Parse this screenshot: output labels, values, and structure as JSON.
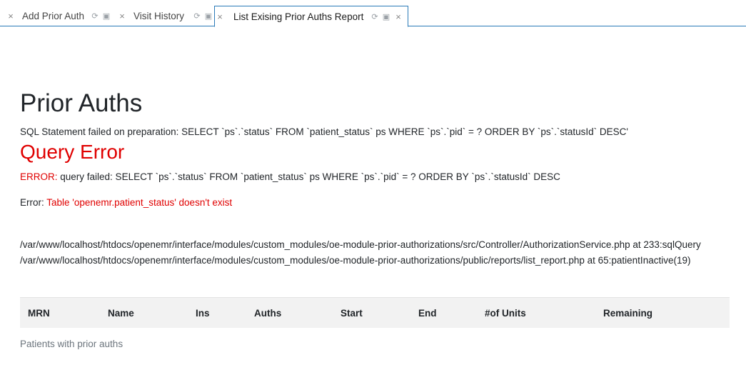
{
  "tabs": [
    {
      "label": "Add Prior Auth",
      "active": false
    },
    {
      "label": "Visit History",
      "active": false
    },
    {
      "label": "List Exising Prior Auths Report",
      "active": true
    }
  ],
  "icons": {
    "close": "×",
    "refresh": "⟳",
    "lock": "🔒"
  },
  "page": {
    "title": "Prior Auths",
    "sql_failed": "SQL Statement failed on preparation: SELECT `ps`.`status` FROM `patient_status` ps WHERE `ps`.`pid` = ? ORDER BY `ps`.`statusId` DESC'",
    "query_error_title": "Query Error",
    "error_label": "ERROR:",
    "error_text": " query failed: SELECT `ps`.`status` FROM `patient_status` ps WHERE `ps`.`pid` = ? ORDER BY `ps`.`statusId` DESC",
    "error2_label": "Error: ",
    "error2_text": "Table 'openemr.patient_status' doesn't exist",
    "trace": [
      "/var/www/localhost/htdocs/openemr/interface/modules/custom_modules/oe-module-prior-authorizations/src/Controller/AuthorizationService.php at 233:sqlQuery",
      "/var/www/localhost/htdocs/openemr/interface/modules/custom_modules/oe-module-prior-authorizations/public/reports/list_report.php at 65:patientInactive(19)"
    ]
  },
  "table": {
    "headers": [
      "MRN",
      "Name",
      "Ins",
      "Auths",
      "Start",
      "End",
      "#of Units",
      "Remaining"
    ],
    "caption": "Patients with prior auths"
  },
  "colors": {
    "accent": "#2a7ab8",
    "error": "#e00000"
  }
}
